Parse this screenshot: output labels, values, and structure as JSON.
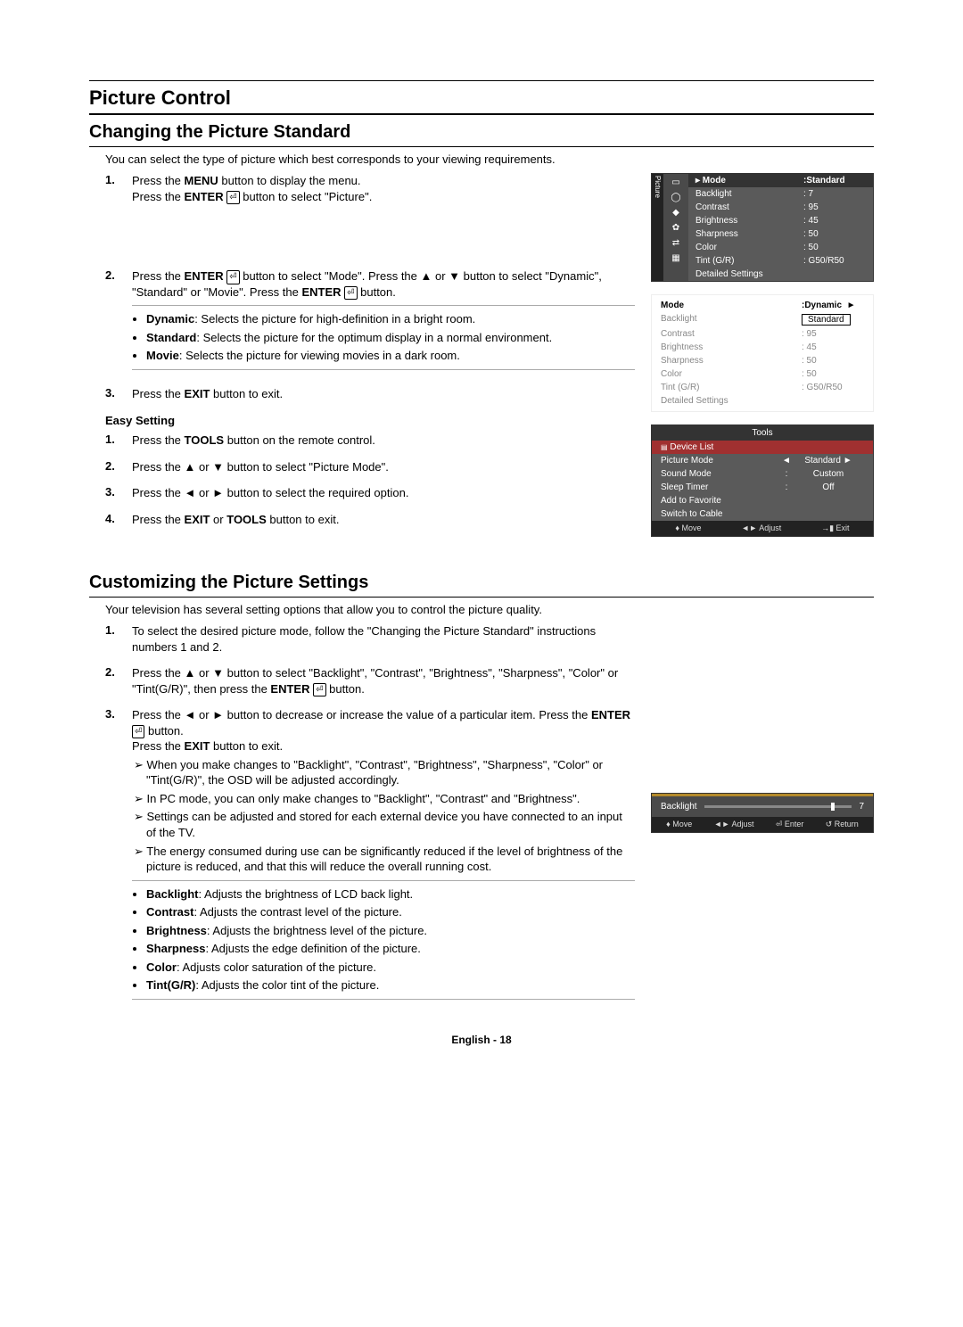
{
  "section_title": "Picture Control",
  "h2a": "Changing the Picture Standard",
  "introA": "You can select the type of picture which best corresponds to your viewing requirements.",
  "step1_a": "Press the ",
  "step1_b": "MENU",
  "step1_c": " button to display the menu.",
  "step1_d": "Press the ",
  "step1_e": "ENTER",
  "step1_f": " button to select \"Picture\".",
  "step2_a": "Press the ",
  "step2_b": "ENTER",
  "step2_c": " button to select \"Mode\". Press the ▲ or ▼ button to select \"Dynamic\", \"Standard\" or \"Movie\". Press the ",
  "step2_d": "ENTER",
  "step2_e": " button.",
  "mode_dyn_b": "Dynamic",
  "mode_dyn": ": Selects the picture for high-definition in a bright room.",
  "mode_std_b": "Standard",
  "mode_std": ": Selects the picture for the optimum display in a normal environment.",
  "mode_mov_b": "Movie",
  "mode_mov": ": Selects the picture for viewing movies in a dark room.",
  "step3_a": "Press the ",
  "step3_b": "EXIT",
  "step3_c": " button to exit.",
  "easy_title": "Easy Setting",
  "easy1_a": "Press the ",
  "easy1_b": "TOOLS",
  "easy1_c": " button on the remote control.",
  "easy2": "Press the ▲ or ▼ button to select \"Picture Mode\".",
  "easy3": "Press the ◄ or ► button to select the required option.",
  "easy4_a": "Press the ",
  "easy4_b": "EXIT",
  "easy4_c": " or ",
  "easy4_d": "TOOLS",
  "easy4_e": " button to exit.",
  "h2b": "Customizing the Picture Settings",
  "introB": "Your television has several setting options that allow you to control the picture quality.",
  "cstep1": "To select the desired picture mode, follow the \"Changing the Picture Standard\" instructions numbers 1 and 2.",
  "cstep2_a": "Press the ▲ or ▼ button to select \"Backlight\", \"Contrast\", \"Brightness\", \"Sharpness\", \"Color\" or \"Tint(G/R)\", then press the ",
  "cstep2_b": "ENTER",
  "cstep2_c": " button.",
  "cstep3_a": "Press the ◄ or ► button to decrease or increase the value of a particular item. Press the ",
  "cstep3_b": "ENTER",
  "cstep3_c": " button.",
  "cstep3_d": "Press the ",
  "cstep3_e": "EXIT",
  "cstep3_f": " button to exit.",
  "note1": "When you make changes to \"Backlight\", \"Contrast\", \"Brightness\", \"Sharpness\", \"Color\" or \"Tint(G/R)\", the OSD will be adjusted accordingly.",
  "note2": "In PC mode, you can only make changes to \"Backlight\", \"Contrast\" and \"Brightness\".",
  "note3": "Settings can be adjusted and stored for each external device you have connected to an input of the TV.",
  "note4": "The energy consumed during use can be significantly reduced if the level of brightness of the picture is reduced, and that this will reduce the overall running cost.",
  "def_bl_b": "Backlight",
  "def_bl": ": Adjusts the brightness of LCD back light.",
  "def_ct_b": "Contrast",
  "def_ct": ": Adjusts the contrast level of the picture.",
  "def_br_b": "Brightness",
  "def_br": ": Adjusts the brightness level of the picture.",
  "def_sh_b": "Sharpness",
  "def_sh": ": Adjusts the edge definition of the picture.",
  "def_co_b": "Color",
  "def_co": ": Adjusts color saturation of the picture.",
  "def_ti_b": "Tint(G/R)",
  "def_ti": ": Adjusts the color tint of the picture.",
  "footer": "English - 18",
  "osd1": {
    "tab": "Picture",
    "rows": [
      {
        "l": "Mode",
        "v": ":Standard",
        "hl": true
      },
      {
        "l": "Backlight",
        "v": ": 7"
      },
      {
        "l": "Contrast",
        "v": ": 95"
      },
      {
        "l": "Brightness",
        "v": ": 45"
      },
      {
        "l": "Sharpness",
        "v": ": 50"
      },
      {
        "l": "Color",
        "v": ": 50"
      },
      {
        "l": "Tint (G/R)",
        "v": ": G50/R50"
      },
      {
        "l": "Detailed Settings",
        "v": ""
      }
    ]
  },
  "osd2": {
    "top_l": "Mode",
    "top_v": ":Dynamic",
    "arrow": "►",
    "box": "Standard",
    "rows": [
      {
        "l": "Backlight",
        "v": ""
      },
      {
        "l": "Contrast",
        "v": ": 95"
      },
      {
        "l": "Brightness",
        "v": ": 45"
      },
      {
        "l": "Sharpness",
        "v": ": 50"
      },
      {
        "l": "Color",
        "v": ": 50"
      },
      {
        "l": "Tint (G/R)",
        "v": ": G50/R50"
      },
      {
        "l": "Detailed Settings",
        "v": ""
      }
    ]
  },
  "osd3": {
    "title": "Tools",
    "rows": [
      {
        "l": "Device List",
        "c": "",
        "r": "",
        "red": true,
        "sub": true
      },
      {
        "l": "Picture Mode",
        "c": "◄",
        "r": "Standard   ►"
      },
      {
        "l": "Sound Mode",
        "c": ":",
        "r": "Custom"
      },
      {
        "l": "Sleep Timer",
        "c": ":",
        "r": "Off"
      },
      {
        "l": "Add to Favorite",
        "c": "",
        "r": ""
      },
      {
        "l": "Switch to Cable",
        "c": "",
        "r": ""
      }
    ],
    "footer": [
      "♦ Move",
      "◄► Adjust",
      "→▮ Exit"
    ]
  },
  "osd4": {
    "label": "Backlight",
    "value": "7",
    "footer": [
      "♦ Move",
      "◄► Adjust",
      "⏎ Enter",
      "↺ Return"
    ]
  }
}
